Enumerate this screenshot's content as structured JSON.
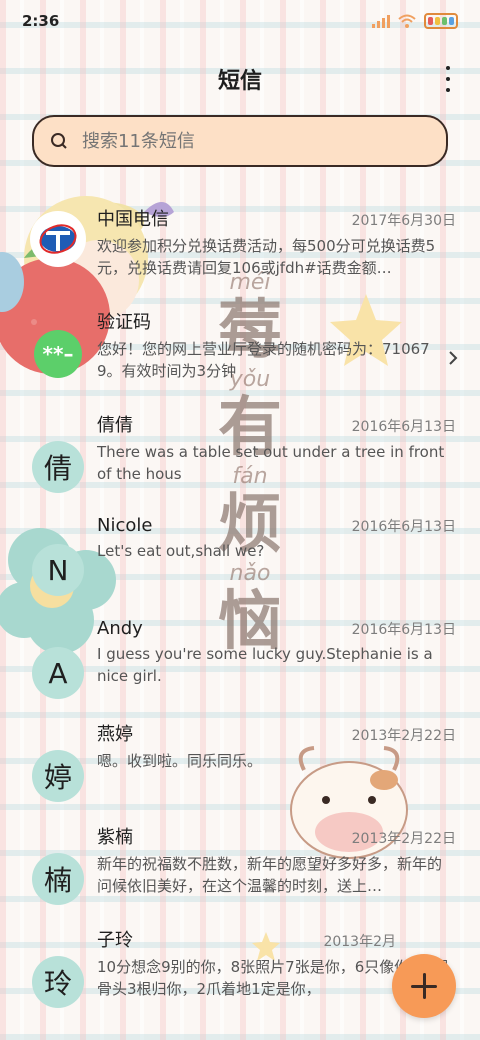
{
  "status_bar": {
    "time": "2:36",
    "signal_icon": "signal-icon",
    "wifi_icon": "wifi-icon",
    "battery_icon": "battery-icon",
    "battery_colors": [
      "#e45c5c",
      "#f0c040",
      "#6cc06c",
      "#5aa0e0"
    ]
  },
  "header": {
    "title": "短信",
    "more_icon": "more-vertical-icon"
  },
  "search": {
    "placeholder": "搜索11条短信",
    "icon": "search-icon"
  },
  "watermark": [
    {
      "pinyin": "méi",
      "hanzi": "莓"
    },
    {
      "pinyin": "yǒu",
      "hanzi": "有"
    },
    {
      "pinyin": "fán",
      "hanzi": "烦"
    },
    {
      "pinyin": "nǎo",
      "hanzi": "恼"
    }
  ],
  "conversations": [
    {
      "sender": "中国电信",
      "date": "2017年6月30日",
      "preview": "欢迎参加积分兑换话费活动，每500分可兑换话费5元，兑换话费请回复106或jfdh#话费金额…",
      "avatar": "",
      "avatar_icon": "china-telecom-logo-icon",
      "avatar_color": "#ffffff"
    },
    {
      "sender": "验证码",
      "date": "",
      "preview": "您好！您的网上营业厅登录的随机密码为：710679。有效时间为3分钟",
      "avatar": "**–",
      "avatar_color": "#5ccf6a",
      "chevron_icon": "chevron-right-icon"
    },
    {
      "sender": "倩倩",
      "date": "2016年6月13日",
      "preview": "There was a table set out under a tree in front of the hous",
      "avatar": "倩",
      "avatar_color": "#b8e1d9"
    },
    {
      "sender": "Nicole",
      "date": "2016年6月13日",
      "preview": "Let's eat out,shall we?",
      "avatar": "N",
      "avatar_color": "#b8e1d9"
    },
    {
      "sender": "Andy",
      "date": "2016年6月13日",
      "preview": "I guess you're some lucky guy.Stephanie is a nice girl.",
      "avatar": "A",
      "avatar_color": "#b8e1d9"
    },
    {
      "sender": "燕婷",
      "date": "2013年2月22日",
      "preview": "嗯。收到啦。同乐同乐。",
      "avatar": "婷",
      "avatar_color": "#b8e1d9"
    },
    {
      "sender": "紫楠",
      "date": "2013年2月22日",
      "preview": "新年的祝福数不胜数，新年的愿望好多好多，新年的问候依旧美好，在这个温馨的时刻，送上…",
      "avatar": "楠",
      "avatar_color": "#b8e1d9"
    },
    {
      "sender": "子玲",
      "date": "2013年2月",
      "preview": "10分想念9别的你，8张照片7张是你，6只像你，4根骨头3根归你，2爪着地1定是你，",
      "avatar": "玲",
      "avatar_color": "#b8e1d9"
    }
  ],
  "fab": {
    "icon": "plus-icon",
    "color": "#f79a57"
  }
}
